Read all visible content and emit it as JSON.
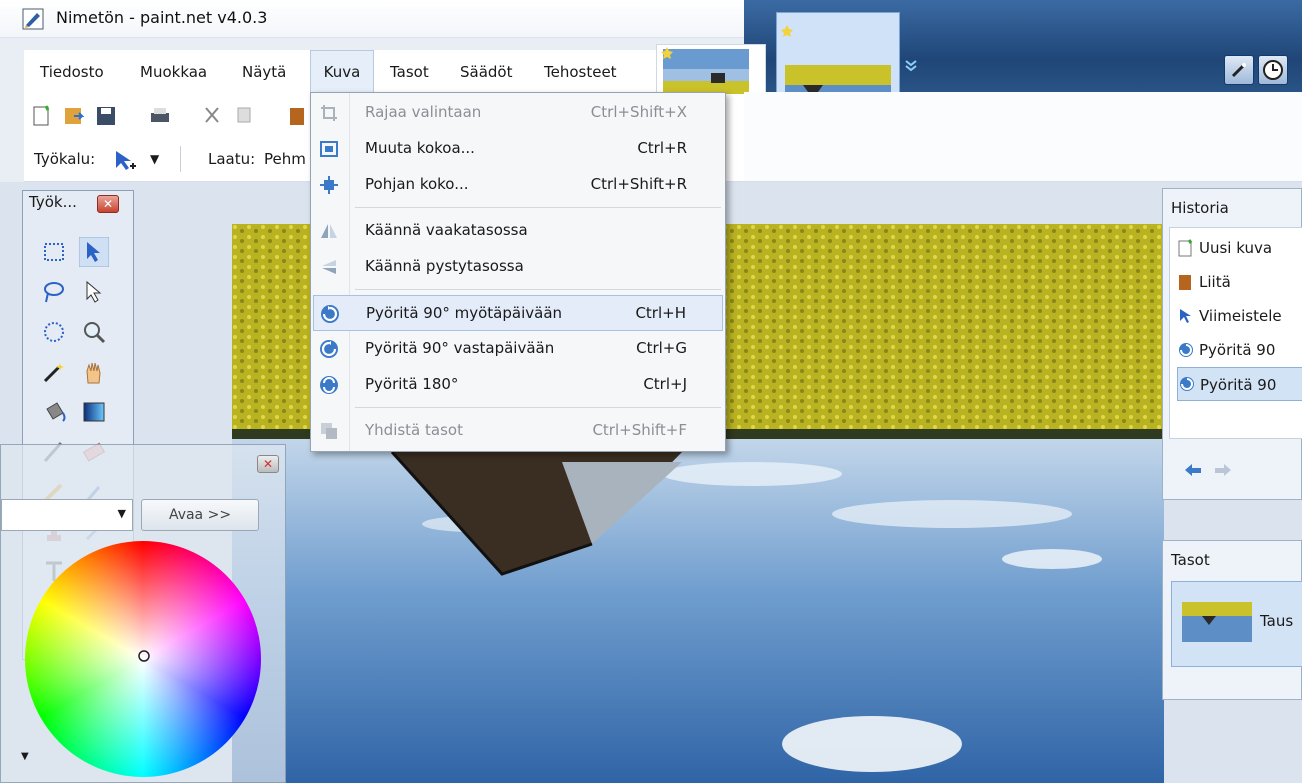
{
  "window": {
    "title": "Nimetön - paint.net v4.0.3"
  },
  "menubar": {
    "items": [
      {
        "label": "Tiedosto"
      },
      {
        "label": "Muokkaa"
      },
      {
        "label": "Näytä"
      },
      {
        "label": "Kuva"
      },
      {
        "label": "Tasot"
      },
      {
        "label": "Säädöt"
      },
      {
        "label": "Tehosteet"
      }
    ],
    "active": "Kuva"
  },
  "toolbar": {
    "tool_label": "Työkalu:",
    "quality_label": "Laatu:",
    "quality_value": "Pehm"
  },
  "kuva_menu": {
    "items": [
      {
        "label": "Rajaa valintaan",
        "shortcut": "Ctrl+Shift+X",
        "icon": "crop-icon",
        "disabled": true
      },
      {
        "label": "Muuta kokoa...",
        "shortcut": "Ctrl+R",
        "icon": "resize-icon",
        "disabled": false
      },
      {
        "label": "Pohjan koko...",
        "shortcut": "Ctrl+Shift+R",
        "icon": "canvas-size-icon",
        "disabled": false
      },
      {
        "label": "Käännä vaakatasossa",
        "shortcut": "",
        "icon": "flip-horizontal-icon",
        "disabled": false
      },
      {
        "label": "Käännä pystytasossa",
        "shortcut": "",
        "icon": "flip-vertical-icon",
        "disabled": false
      },
      {
        "label": "Pyöritä 90° myötäpäivään",
        "shortcut": "Ctrl+H",
        "icon": "rotate-cw-icon",
        "disabled": false,
        "highlighted": true
      },
      {
        "label": "Pyöritä 90° vastapäivään",
        "shortcut": "Ctrl+G",
        "icon": "rotate-ccw-icon",
        "disabled": false
      },
      {
        "label": "Pyöritä 180°",
        "shortcut": "Ctrl+J",
        "icon": "rotate-180-icon",
        "disabled": false
      },
      {
        "label": "Yhdistä tasot",
        "shortcut": "Ctrl+Shift+F",
        "icon": "flatten-icon",
        "disabled": true
      }
    ]
  },
  "tools_panel": {
    "title": "Työk..."
  },
  "colors_panel": {
    "button_label": "Avaa >>"
  },
  "history_panel": {
    "title": "Historia",
    "items": [
      {
        "label": "Uusi kuva",
        "icon": "new-image-icon"
      },
      {
        "label": "Liitä",
        "icon": "paste-icon"
      },
      {
        "label": "Viimeistele",
        "icon": "move-selection-icon"
      },
      {
        "label": "Pyöritä 90",
        "icon": "rotate-cw-icon"
      },
      {
        "label": "Pyöritä 90",
        "icon": "rotate-cw-icon",
        "selected": true
      }
    ]
  },
  "layers_panel": {
    "title": "Tasot",
    "layer_name": "Taus"
  },
  "colors": {
    "accent": "#3b79c9",
    "menu_highlight": "#e3ecf8",
    "close_red": "#c7432f",
    "rapeseed_yellow": "#c9c22a",
    "sky_blue": "#4c7fb8"
  }
}
